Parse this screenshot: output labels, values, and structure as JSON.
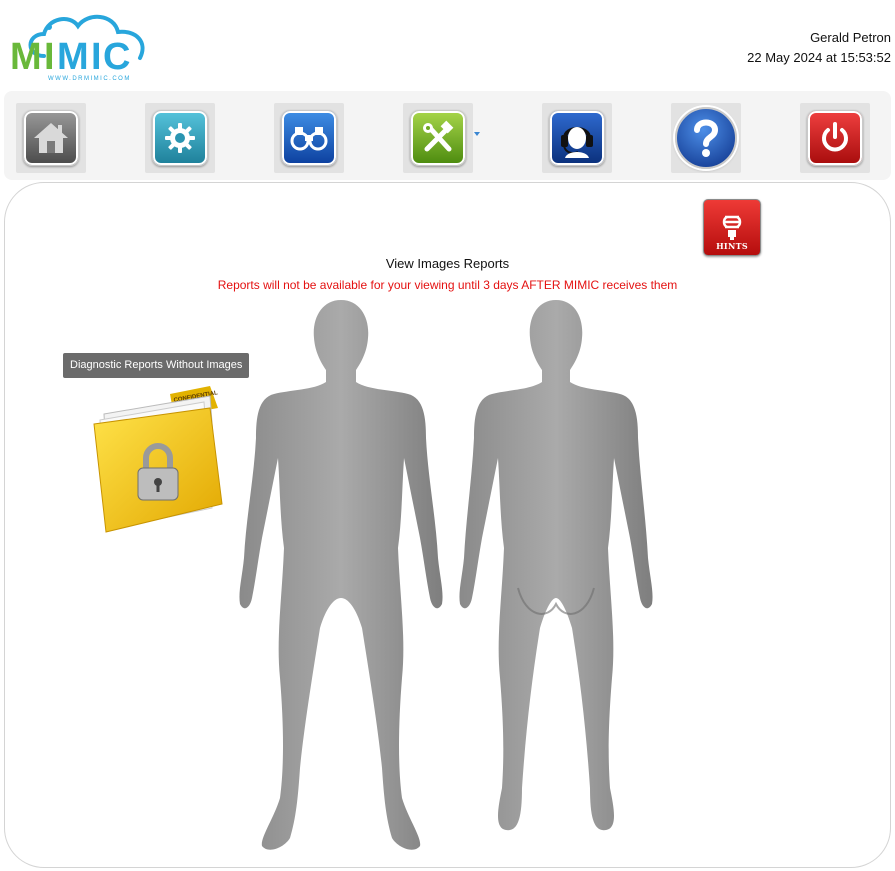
{
  "brand": {
    "logo_text": "MIMIC",
    "logo_url_text": "WWW.DRMIMIC.COM",
    "colors": {
      "green": "#69b83a",
      "blue": "#28a6dc"
    }
  },
  "user": {
    "name": "Gerald Petron",
    "datetime": "22 May 2024 at 15:53:52"
  },
  "toolbar": {
    "buttons": [
      {
        "name": "home",
        "icon": "home-icon"
      },
      {
        "name": "settings",
        "icon": "gear-icon"
      },
      {
        "name": "search",
        "icon": "binoculars-icon"
      },
      {
        "name": "tools",
        "icon": "tools-icon",
        "has_dropdown": true
      },
      {
        "name": "support",
        "icon": "headset-icon"
      },
      {
        "name": "help",
        "icon": "question-icon"
      },
      {
        "name": "logout",
        "icon": "power-icon"
      }
    ]
  },
  "hints": {
    "label": "HINTS",
    "icon": "lightbulb-icon"
  },
  "main": {
    "title": "View Images Reports",
    "notice": "Reports will not be available for your viewing until 3 days AFTER MIMIC receives them",
    "notice_color": "#e41111",
    "tooltip": "Diagnostic Reports Without Images",
    "folder_label": "CONFIDENTIAL",
    "folder_icon": "locked-folder-icon",
    "figures": [
      "body-front",
      "body-back"
    ]
  }
}
